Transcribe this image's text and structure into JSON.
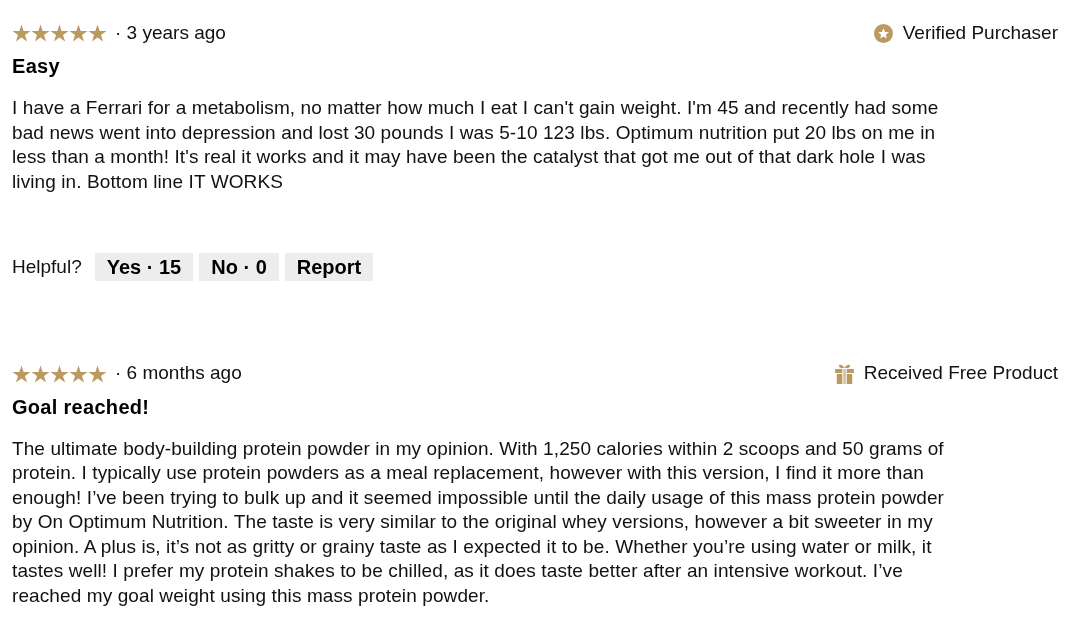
{
  "reviews": [
    {
      "stars": 5,
      "age": "· 3 years ago",
      "badge": {
        "kind": "verified",
        "label": "Verified Purchaser"
      },
      "title": "Easy",
      "body": "I have a Ferrari for a metabolism, no matter how much I eat I can't gain weight. I'm 45 and recently had some bad news went into depression and lost 30 pounds I was 5-10 123 lbs. Optimum nutrition put 20 lbs on me in less than a month! It's real it works and it may have been the catalyst that got me out of that dark hole I was living in. Bottom line IT WORKS",
      "helpful": {
        "label": "Helpful?",
        "buttons": [
          "Yes · 15",
          "No · 0",
          "Report"
        ]
      }
    },
    {
      "stars": 5,
      "age": "· 6 months ago",
      "badge": {
        "kind": "free_product",
        "label": "Received Free Product"
      },
      "title": "Goal reached!",
      "body": "The ultimate body-building protein powder in my opinion. With 1,250 calories within 2 scoops and 50 grams of protein. I typically use protein powders as a meal replacement, however with this version, I find it more than enough! I’ve been trying to bulk up and it seemed impossible until the daily usage of this mass protein powder by On Optimum Nutrition. The taste is very similar to the original whey versions, however a bit sweeter in my opinion. A plus is, it’s not as gritty or grainy taste as I expected it to be. Whether you’re using water or milk, it tastes well! I prefer my protein shakes to be chilled, as it does taste better after an intensive workout. I’ve reached my goal weight using this mass protein powder."
    }
  ]
}
